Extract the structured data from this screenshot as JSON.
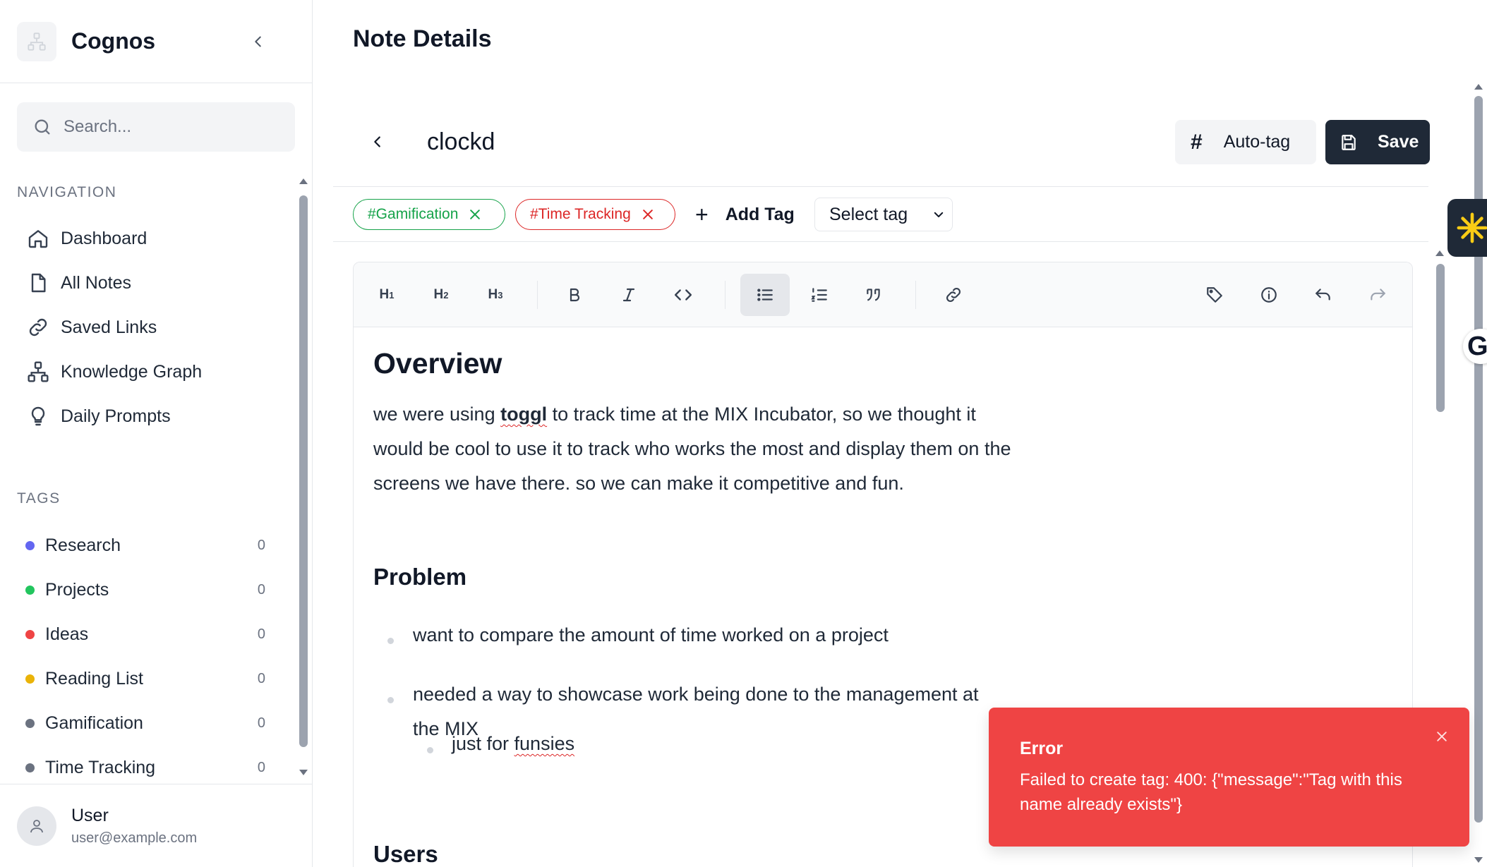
{
  "sidebar": {
    "brand": "Cognos",
    "search_placeholder": "Search...",
    "nav_heading": "NAVIGATION",
    "nav_items": [
      {
        "label": "Dashboard",
        "icon": "home-icon"
      },
      {
        "label": "All Notes",
        "icon": "file-icon"
      },
      {
        "label": "Saved Links",
        "icon": "link-icon"
      },
      {
        "label": "Knowledge Graph",
        "icon": "network-icon"
      },
      {
        "label": "Daily Prompts",
        "icon": "lightbulb-icon"
      }
    ],
    "tags_heading": "TAGS",
    "tags": [
      {
        "label": "Research",
        "count": "0",
        "color": "#6366f1"
      },
      {
        "label": "Projects",
        "count": "0",
        "color": "#22c55e"
      },
      {
        "label": "Ideas",
        "count": "0",
        "color": "#ef4444"
      },
      {
        "label": "Reading List",
        "count": "0",
        "color": "#eab308"
      },
      {
        "label": "Gamification",
        "count": "0",
        "color": "#6b7280"
      },
      {
        "label": "Time Tracking",
        "count": "0",
        "color": "#6b7280"
      }
    ],
    "user": {
      "name": "User",
      "email": "user@example.com"
    }
  },
  "main": {
    "page_title": "Note Details",
    "note_title": "clockd",
    "autotag_label": "Auto-tag",
    "save_label": "Save",
    "chips": [
      {
        "label": "#Gamification",
        "color": "#16a34a"
      },
      {
        "label": "#Time Tracking",
        "color": "#dc2626"
      }
    ],
    "add_tag_label": "Add Tag",
    "select_tag_value": "Select tag"
  },
  "toolbar": {
    "h1": "H",
    "h1_sub": "1",
    "h2": "H",
    "h2_sub": "2",
    "h3": "H",
    "h3_sub": "3",
    "active_button": "bullet-list"
  },
  "content": {
    "overview_heading": "Overview",
    "overview_pre": "we were using ",
    "overview_misspelled": "toggl",
    "overview_post": " to track time at the MIX Incubator, so we thought it would be cool to use it to track who works the most and display them on the screens we have there. so we can make it competitive and fun.",
    "problem_heading": "Problem",
    "bullet1": "want to compare the amount of time worked on a project",
    "bullet2_line1": "needed a way to showcase work being done to the management at",
    "bullet2_line2": "the MIX",
    "sub_bullet_pre": "just for ",
    "sub_bullet_misspelled": "funsies",
    "users_heading": "Users"
  },
  "toast": {
    "title": "Error",
    "message": "Failed to create tag: 400: {\"message\":\"Tag with this name already exists\"}"
  }
}
